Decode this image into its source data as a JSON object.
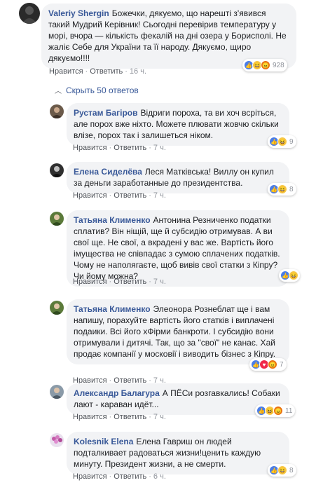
{
  "hide_replies_label": "Скрыть 50 ответов",
  "comments": [
    {
      "author": "Valeriy Shergin",
      "text": "Божечки, дякуємо, що нарешті з'явився такий Мудрий Керівник! Сьогодні перевірив температуру у морі, вчора — кількість фекалій на дні озера у Борисполі. Не жаліє Себе для України та її народу. Дякуємо, щиро дякуємо!!!!",
      "like_label": "Нравится",
      "reply_label": "Ответить",
      "time": "16 ч.",
      "reactions": [
        "like-icon",
        "haha-icon",
        "angry-icon"
      ],
      "reaction_count": "928"
    },
    {
      "author": "Рустам Багіров",
      "text": "Відриги пороха, та ви хоч всріться, але порох вже ніхто. Можете плювати жовчю скільки влізе, порох так і залишеться ніком.",
      "like_label": "Нравится",
      "reply_label": "Ответить",
      "time": "7 ч.",
      "reactions": [
        "like-icon",
        "haha-icon"
      ],
      "reaction_count": "9"
    },
    {
      "author": "Елена Сиделёва",
      "text": "Леся Матківська! Виллу он купил за деньги заработанные до президентства.",
      "like_label": "Нравится",
      "reply_label": "Ответить",
      "time": "7 ч.",
      "reactions": [
        "like-icon",
        "haha-icon"
      ],
      "reaction_count": "8"
    },
    {
      "author": "Татьяна Клименко",
      "text": "Антонина Резниченко податки сплатив? Він ніщій, ще й субсидію отримував. А ви свої ще. Не свої, а вкрадені у вас же. Вартість його імущества не співпадає з сумою сплачених податків. Чому не наполягаєте, щоб вивів свої статки з Кіпру? Чи йому можна?",
      "like_label": "Нравится",
      "reply_label": "Ответить",
      "time": "7 ч.",
      "reactions": [
        "like-icon",
        "haha-icon"
      ],
      "reaction_count": ""
    },
    {
      "author": "Татьяна Клименко",
      "text": "Элеонора Рознеблат ще і вам напишу, порахуйте вартість його статків і виплачені подаики. Всі його хФірми банкроти. І субсидію вони отримували і дитячі. Так, що за \"свої\" не канає. Хай продає компанії у московії і виводить бізнес з Кіпру.",
      "like_label": "Нравится",
      "reply_label": "Ответить",
      "time": "7 ч.",
      "reactions": [
        "like-icon",
        "love-icon",
        "angry-icon"
      ],
      "reaction_count": "7"
    },
    {
      "author": "Александр Балагура",
      "text": "А ПЁСи розгавкались! Собаки лают - караван идёт...",
      "like_label": "Нравится",
      "reply_label": "Ответить",
      "time": "7 ч.",
      "reactions": [
        "like-icon",
        "haha-icon",
        "angry-icon"
      ],
      "reaction_count": "11"
    },
    {
      "author": "Kolesnik Elena",
      "text": "Елена Гавриш он людей подталкивает радоваться жизни!ценить каждую минуту. Президент жизни, а не смерти.",
      "like_label": "Нравится",
      "reply_label": "Ответить",
      "time": "6 ч.",
      "reactions": [
        "like-icon",
        "haha-icon"
      ],
      "reaction_count": "8"
    }
  ],
  "colors": {
    "author": "#385898",
    "bubble": "#f2f3f5",
    "meta": "#90949c",
    "like": "#4a7de8",
    "haha": "#f7c948",
    "angry": "#e9710f",
    "love": "#f0284a"
  }
}
